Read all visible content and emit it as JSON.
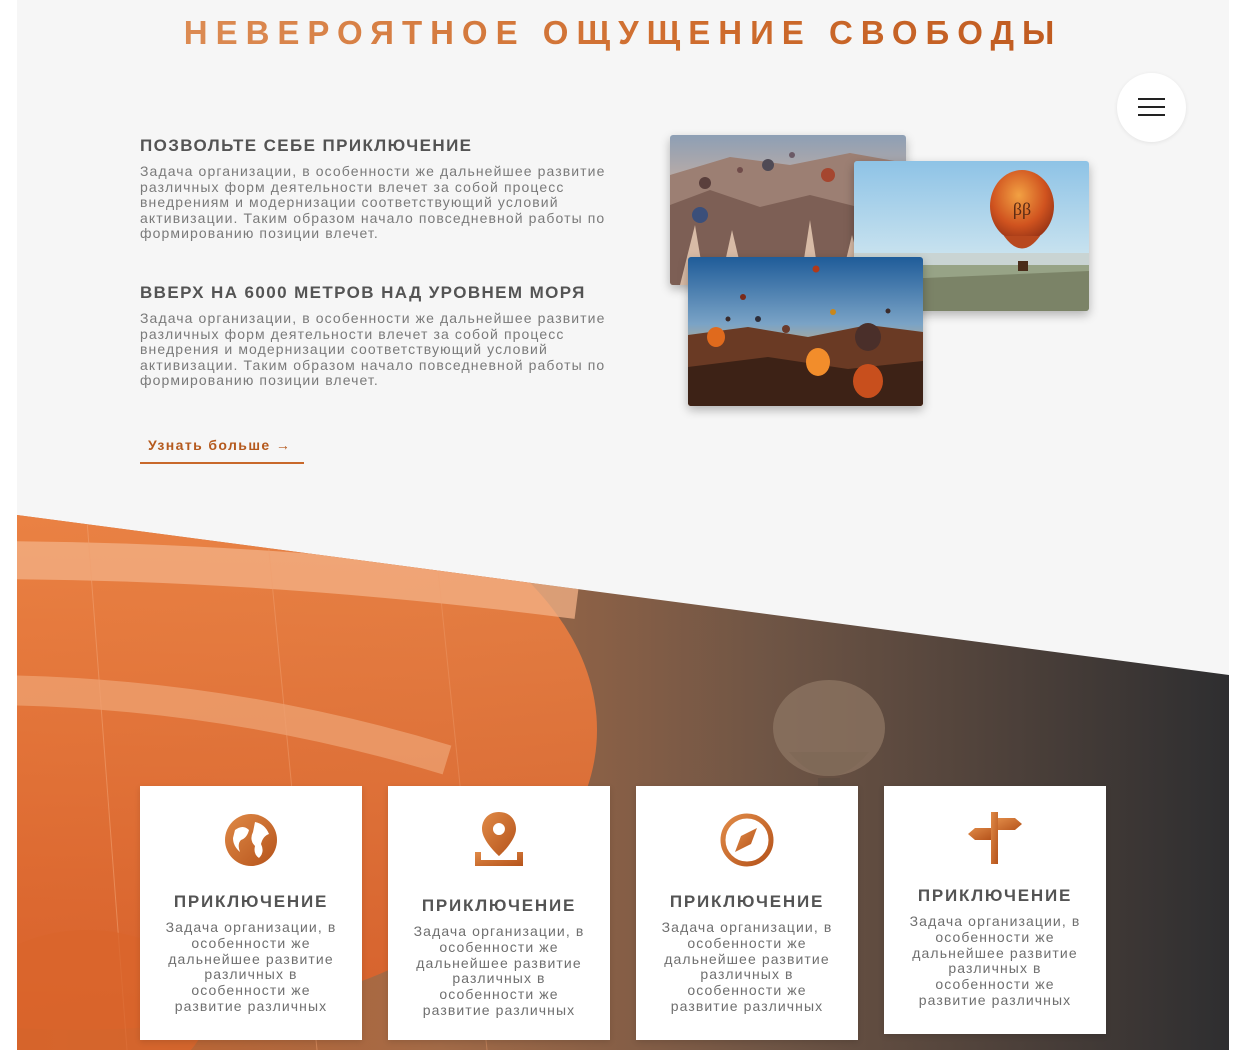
{
  "header": {
    "title": "НЕВЕРОЯТНОЕ ОЩУЩЕНИЕ СВОБОДЫ"
  },
  "menu": {
    "icon": "hamburger-menu-icon"
  },
  "intro": {
    "blocks": [
      {
        "heading": "ПОЗВОЛЬТЕ СЕБЕ ПРИКЛЮЧЕНИЕ",
        "text": "Задача организации, в особенности же дальнейшее развитие различных форм деятельности влечет за собой процесс внедрениям и модернизации соответствующий условий активизации. Таким образом начало повседневной работы по формированию позиции влечет."
      },
      {
        "heading": "ВВЕРХ НА 6000 МЕТРОВ НАД УРОВНЕМ МОРЯ",
        "text": "Задача организации, в особенности же дальнейшее развитие различных форм деятельности влечет за собой процесс внедрения и модернизации соответствующий условий активизации. Таким образом начало повседневной работы по формированию позиции влечет."
      }
    ],
    "more_link": "Узнать больше →"
  },
  "colors": {
    "accent": "#c8682a",
    "accent_dark": "#b55a1e",
    "background": "#f6f6f6",
    "band_dark": "#2f2f31"
  },
  "features": {
    "cards": [
      {
        "icon": "globe-icon",
        "title": "ПРИКЛЮЧЕНИЕ",
        "text": "Задача организации, в особенности же дальнейшее развитие различных в особенности же развитие различных"
      },
      {
        "icon": "map-pin-icon",
        "title": "ПРИКЛЮЧЕНИЕ",
        "text": "Задача организации, в особенности же дальнейшее развитие различных в особенности же развитие различных"
      },
      {
        "icon": "compass-icon",
        "title": "ПРИКЛЮЧЕНИЕ",
        "text": "Задача организации, в особенности же дальнейшее развитие различных в особенности же развитие различных"
      },
      {
        "icon": "signpost-icon",
        "title": "ПРИКЛЮЧЕНИЕ",
        "text": "Задача организации, в особенности же дальнейшее развитие различных в особенности же развитие различных"
      }
    ]
  }
}
